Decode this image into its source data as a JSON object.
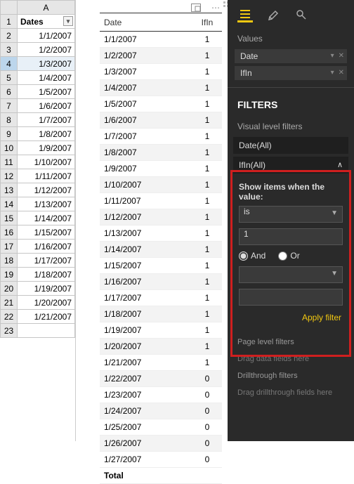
{
  "excel": {
    "col_letter": "A",
    "header_label": "Dates",
    "rows": [
      {
        "n": 1
      },
      {
        "n": 2,
        "val": "1/1/2007"
      },
      {
        "n": 3,
        "val": "1/2/2007"
      },
      {
        "n": 4,
        "val": "1/3/2007",
        "selected": true
      },
      {
        "n": 5,
        "val": "1/4/2007"
      },
      {
        "n": 6,
        "val": "1/5/2007"
      },
      {
        "n": 7,
        "val": "1/6/2007"
      },
      {
        "n": 8,
        "val": "1/7/2007"
      },
      {
        "n": 9,
        "val": "1/8/2007"
      },
      {
        "n": 10,
        "val": "1/9/2007"
      },
      {
        "n": 11,
        "val": "1/10/2007"
      },
      {
        "n": 12,
        "val": "1/11/2007"
      },
      {
        "n": 13,
        "val": "1/12/2007"
      },
      {
        "n": 14,
        "val": "1/13/2007"
      },
      {
        "n": 15,
        "val": "1/14/2007"
      },
      {
        "n": 16,
        "val": "1/15/2007"
      },
      {
        "n": 17,
        "val": "1/16/2007"
      },
      {
        "n": 18,
        "val": "1/17/2007"
      },
      {
        "n": 19,
        "val": "1/18/2007"
      },
      {
        "n": 20,
        "val": "1/19/2007"
      },
      {
        "n": 21,
        "val": "1/20/2007"
      },
      {
        "n": 22,
        "val": "1/21/2007"
      },
      {
        "n": 23,
        "val": ""
      }
    ]
  },
  "visual": {
    "headers": {
      "date": "Date",
      "ifin": "IfIn"
    },
    "rows": [
      {
        "date": "1/1/2007",
        "ifin": 1
      },
      {
        "date": "1/2/2007",
        "ifin": 1
      },
      {
        "date": "1/3/2007",
        "ifin": 1
      },
      {
        "date": "1/4/2007",
        "ifin": 1
      },
      {
        "date": "1/5/2007",
        "ifin": 1
      },
      {
        "date": "1/6/2007",
        "ifin": 1
      },
      {
        "date": "1/7/2007",
        "ifin": 1
      },
      {
        "date": "1/8/2007",
        "ifin": 1
      },
      {
        "date": "1/9/2007",
        "ifin": 1
      },
      {
        "date": "1/10/2007",
        "ifin": 1
      },
      {
        "date": "1/11/2007",
        "ifin": 1
      },
      {
        "date": "1/12/2007",
        "ifin": 1
      },
      {
        "date": "1/13/2007",
        "ifin": 1
      },
      {
        "date": "1/14/2007",
        "ifin": 1
      },
      {
        "date": "1/15/2007",
        "ifin": 1
      },
      {
        "date": "1/16/2007",
        "ifin": 1
      },
      {
        "date": "1/17/2007",
        "ifin": 1
      },
      {
        "date": "1/18/2007",
        "ifin": 1
      },
      {
        "date": "1/19/2007",
        "ifin": 1
      },
      {
        "date": "1/20/2007",
        "ifin": 1
      },
      {
        "date": "1/21/2007",
        "ifin": 1
      },
      {
        "date": "1/22/2007",
        "ifin": 0
      },
      {
        "date": "1/23/2007",
        "ifin": 0
      },
      {
        "date": "1/24/2007",
        "ifin": 0
      },
      {
        "date": "1/25/2007",
        "ifin": 0
      },
      {
        "date": "1/26/2007",
        "ifin": 0
      },
      {
        "date": "1/27/2007",
        "ifin": 0
      }
    ],
    "total_label": "Total"
  },
  "pane": {
    "values_label": "Values",
    "wells": [
      {
        "label": "Date"
      },
      {
        "label": "IfIn"
      }
    ],
    "filters_title": "FILTERS",
    "vlf_label": "Visual level filters",
    "date_card": "Date(All)",
    "ifin_card": "IfIn(All)",
    "show_items": "Show items when the value:",
    "condition_op": "is",
    "condition_val": "1",
    "and_label": "And",
    "or_label": "Or",
    "apply_label": "Apply filter",
    "plf_label": "Page level filters",
    "drag_data": "Drag data fields here",
    "drill_label": "Drillthrough filters",
    "drag_drill": "Drag drillthrough fields here"
  }
}
